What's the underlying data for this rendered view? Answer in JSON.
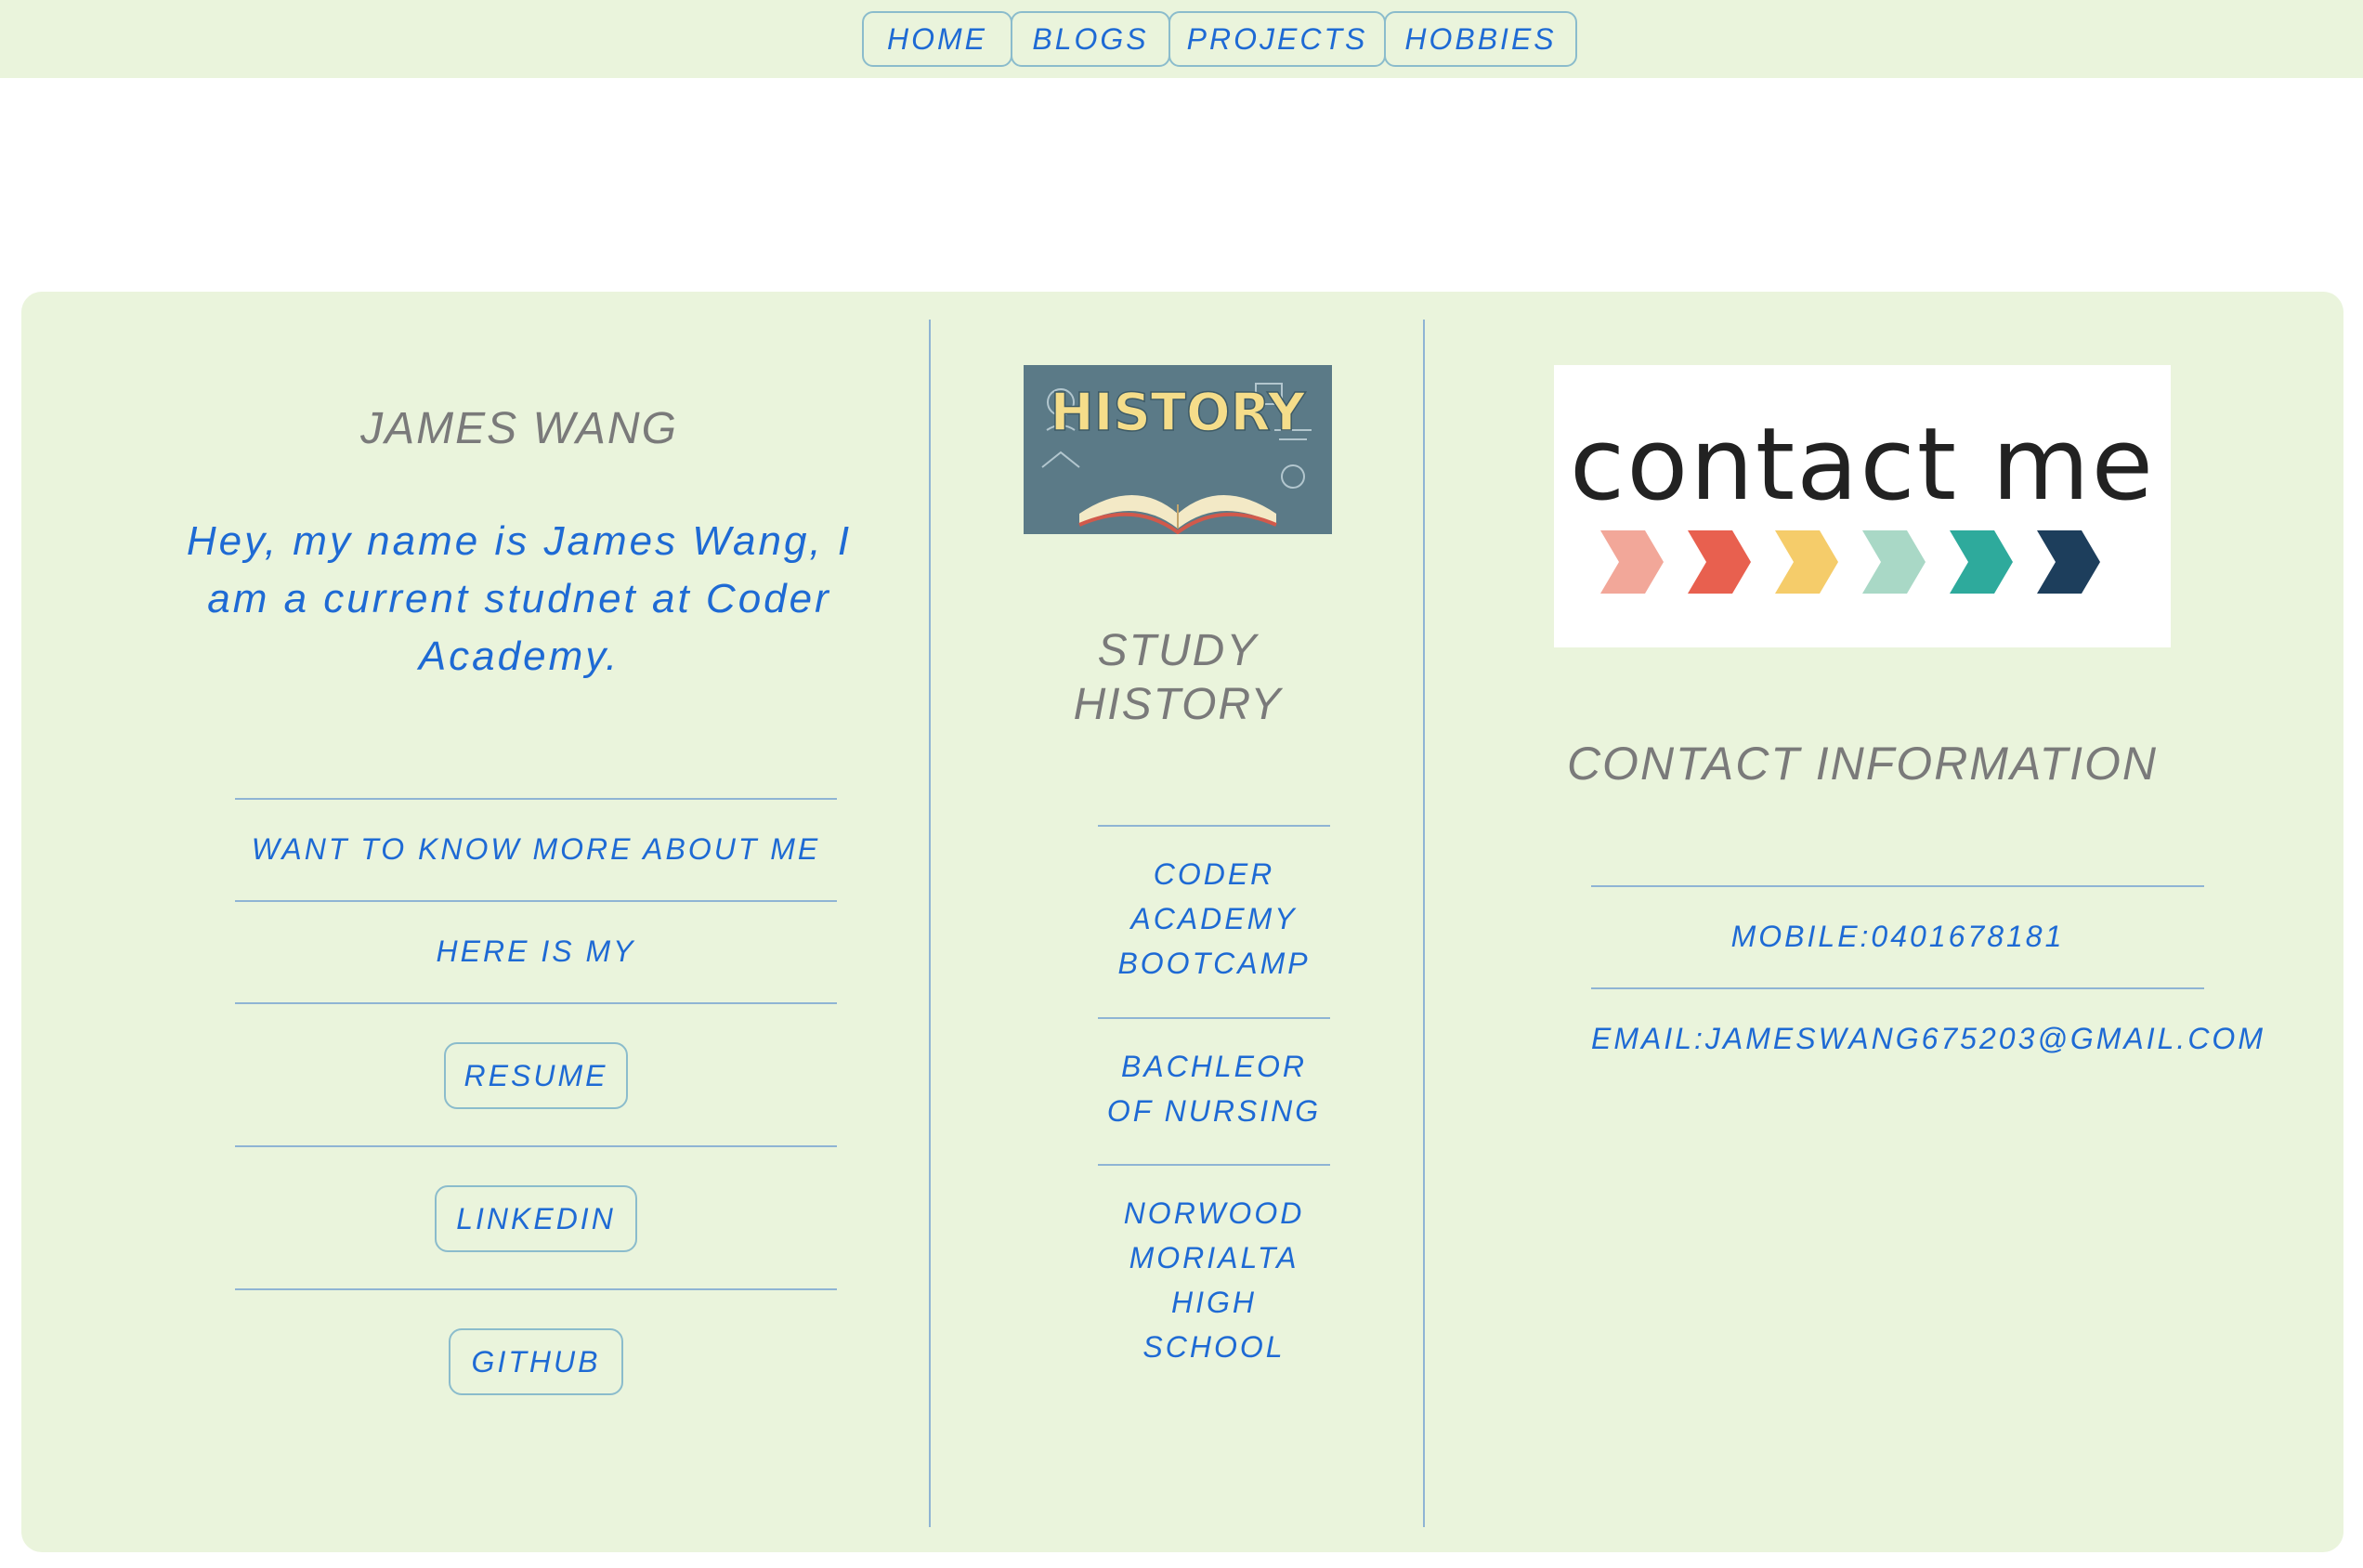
{
  "nav": {
    "items": [
      {
        "label": "HOME"
      },
      {
        "label": "BLOGS"
      },
      {
        "label": "PROJECTS"
      },
      {
        "label": "HOBBIES"
      }
    ]
  },
  "about": {
    "name": "JAMES WANG",
    "intro": "Hey, my name is James Wang, I am a current studnet at Coder Academy.",
    "more_text": "WANT TO KNOW MORE ABOUT ME",
    "here_text": "HERE IS MY",
    "resume_label": "RESUME",
    "linkedin_label": "LINKEDIN",
    "github_label": "GITHUB"
  },
  "study": {
    "image_word": "HISTORY",
    "title": "STUDY HISTORY",
    "items": [
      {
        "label": "CODER ACADEMY BOOTCAMP"
      },
      {
        "label": "BACHLEOR OF NURSING"
      },
      {
        "label": "NORWOOD MORIALTA HIGH SCHOOL"
      }
    ]
  },
  "contact": {
    "image_text": "contact me",
    "title": "CONTACT INFORMATION",
    "mobile": "MOBILE:0401678181",
    "email": "EMAIL:JAMESWANG675203@GMAIL.COM"
  },
  "colors": {
    "panel_bg": "#eaf4dc",
    "link_blue": "#1e6ad4",
    "heading_gray": "#7a7a7a",
    "border": "#8bbccc",
    "history_bg": "#5b7a87",
    "arrows": [
      "#f2a799",
      "#e8604f",
      "#f5cc6a",
      "#a9d8c6",
      "#2eaa9c",
      "#1d3e5c"
    ]
  }
}
